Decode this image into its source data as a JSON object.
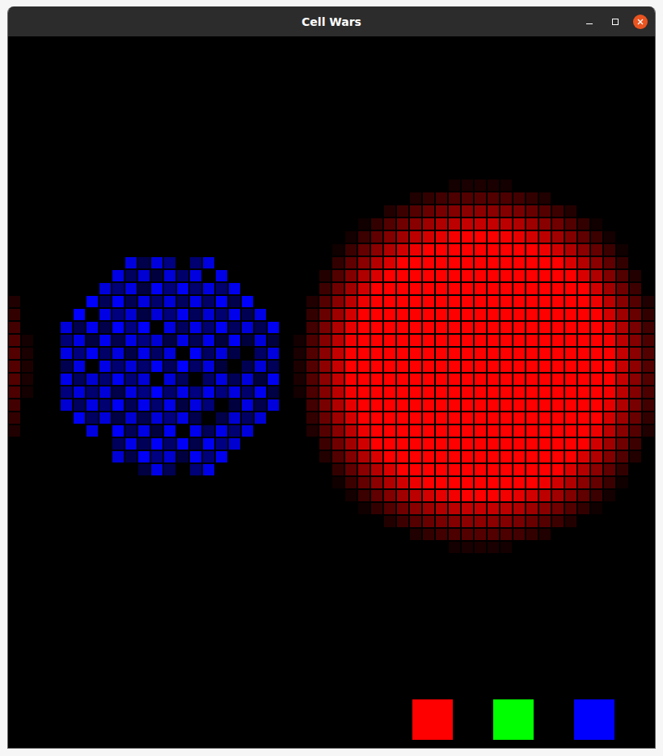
{
  "window": {
    "title": "Cell Wars"
  },
  "colonies": [
    {
      "color": "#ff0000",
      "kind": "solid"
    },
    {
      "color": "#0000ff",
      "kind": "checkered"
    },
    {
      "color": "#ff0000",
      "kind": "solid"
    }
  ],
  "palette": [
    {
      "color": "#ff0000"
    },
    {
      "color": "#00ff00"
    },
    {
      "color": "#0000ff"
    }
  ]
}
